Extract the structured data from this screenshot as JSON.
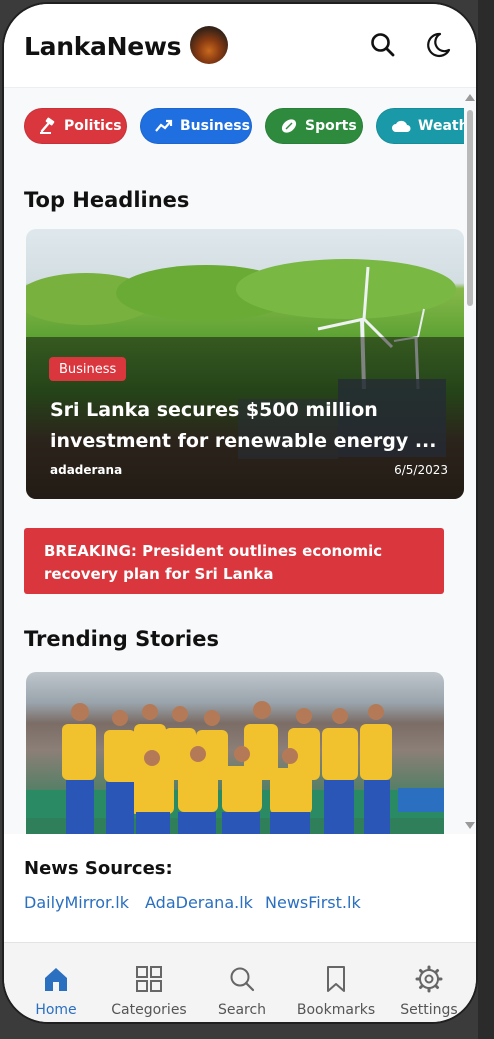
{
  "header": {
    "title": "LankaNews",
    "logo_icon": "app-logo",
    "actions": [
      {
        "icon": "search-icon"
      },
      {
        "icon": "moon-icon"
      }
    ]
  },
  "categories": [
    {
      "label": "Politics",
      "icon": "gavel-icon",
      "color": "#d9363e"
    },
    {
      "label": "Business",
      "icon": "trending-up-icon",
      "color": "#1f6fe0"
    },
    {
      "label": "Sports",
      "icon": "football-icon",
      "color": "#2e8b3e"
    },
    {
      "label": "Weather",
      "icon": "cloud-icon",
      "color": "#1a9aa8"
    }
  ],
  "top_headlines": {
    "heading": "Top Headlines",
    "card": {
      "category": "Business",
      "title": "Sri Lanka secures $500 million investment for renewable energy ...",
      "source": "adaderana",
      "date": "6/5/2023"
    }
  },
  "breaking": {
    "text": "BREAKING: President outlines economic recovery plan for Sri Lanka"
  },
  "trending": {
    "heading": "Trending Stories"
  },
  "news_sources": {
    "heading": "News Sources:",
    "links": [
      "DailyMirror.lk",
      "AdaDerana.lk",
      "NewsFirst.lk"
    ]
  },
  "bottom_nav": {
    "items": [
      {
        "label": "Home",
        "icon": "home-icon",
        "active": true
      },
      {
        "label": "Categories",
        "icon": "grid-icon",
        "active": false
      },
      {
        "label": "Search",
        "icon": "search-icon",
        "active": false
      },
      {
        "label": "Bookmarks",
        "icon": "bookmark-icon",
        "active": false
      },
      {
        "label": "Settings",
        "icon": "gear-icon",
        "active": false
      }
    ]
  },
  "colors": {
    "accent": "#2a6fc0",
    "breaking": "#d9363e"
  }
}
